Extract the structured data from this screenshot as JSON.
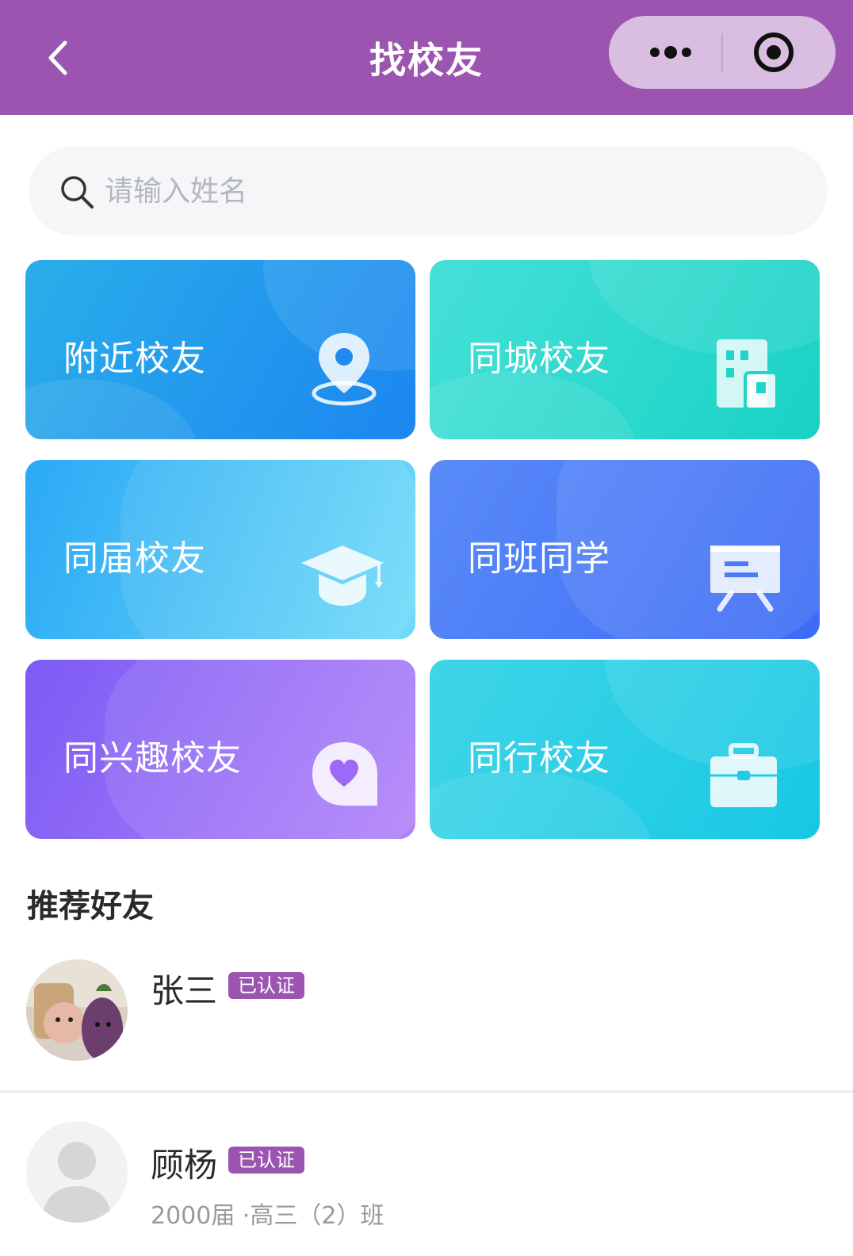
{
  "header": {
    "title": "找校友",
    "icons": {
      "back": "chevron-left-icon",
      "more": "more-dots-icon",
      "close": "target-circle-icon"
    },
    "bg_color": "#9B55B0"
  },
  "search": {
    "placeholder": "请输入姓名",
    "icon": "search-icon"
  },
  "categories": [
    {
      "label": "附近校友",
      "icon": "location-pin-icon"
    },
    {
      "label": "同城校友",
      "icon": "building-icon"
    },
    {
      "label": "同届校友",
      "icon": "graduation-cap-icon"
    },
    {
      "label": "同班同学",
      "icon": "presentation-board-icon"
    },
    {
      "label": "同兴趣校友",
      "icon": "heart-bubble-icon"
    },
    {
      "label": "同行校友",
      "icon": "briefcase-icon"
    }
  ],
  "recommend": {
    "title": "推荐好友",
    "friends": [
      {
        "name": "张三",
        "badge": "已认证",
        "detail": ""
      },
      {
        "name": "顾杨",
        "badge": "已认证",
        "detail": "2000届 ·高三（2）班"
      }
    ]
  }
}
